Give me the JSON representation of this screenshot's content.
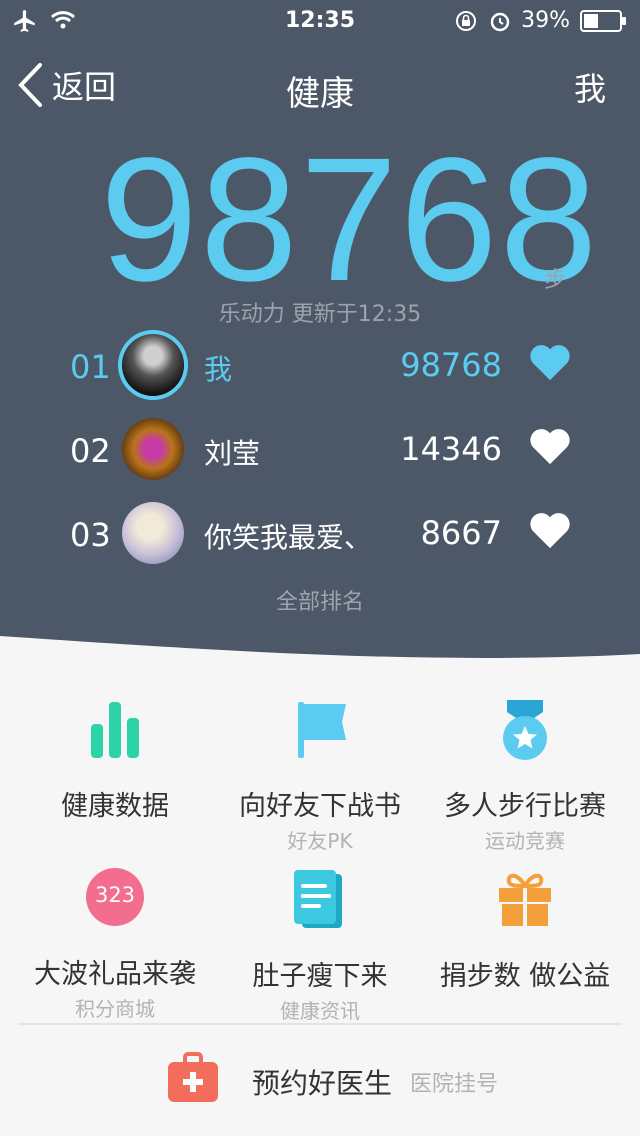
{
  "status": {
    "time": "12:35",
    "battery": "39%"
  },
  "nav": {
    "back": "返回",
    "title": "健康",
    "me": "我"
  },
  "hero": {
    "steps": "98768",
    "unit": "步",
    "updated": "乐动力 更新于12:35"
  },
  "ranking": [
    {
      "rank": "01",
      "name": "我",
      "score": "98768",
      "liked": true
    },
    {
      "rank": "02",
      "name": "刘莹",
      "score": "14346",
      "liked": false
    },
    {
      "rank": "03",
      "name": "你笑我最爱、",
      "score": "8667",
      "liked": false
    }
  ],
  "all_rank": "全部排名",
  "features": [
    {
      "label": "健康数据",
      "sub": "",
      "icon": "bar-chart-icon"
    },
    {
      "label": "向好友下战书",
      "sub": "好友PK",
      "icon": "flag-icon"
    },
    {
      "label": "多人步行比赛",
      "sub": "运动竞赛",
      "icon": "medal-icon"
    },
    {
      "label": "大波礼品来袭",
      "sub": "积分商城",
      "icon": "points-badge-icon",
      "badge": "323"
    },
    {
      "label": "肚子瘦下来",
      "sub": "健康资讯",
      "icon": "document-icon"
    },
    {
      "label": "捐步数 做公益",
      "sub": "",
      "icon": "gift-icon"
    }
  ],
  "bottom": {
    "label": "预约好医生",
    "sub": "医院挂号"
  },
  "colors": {
    "header_bg": "#4c5867",
    "accent": "#5ccbf0",
    "green": "#2dd4a8",
    "coral": "#f36d6d",
    "orange": "#f4a03a"
  }
}
